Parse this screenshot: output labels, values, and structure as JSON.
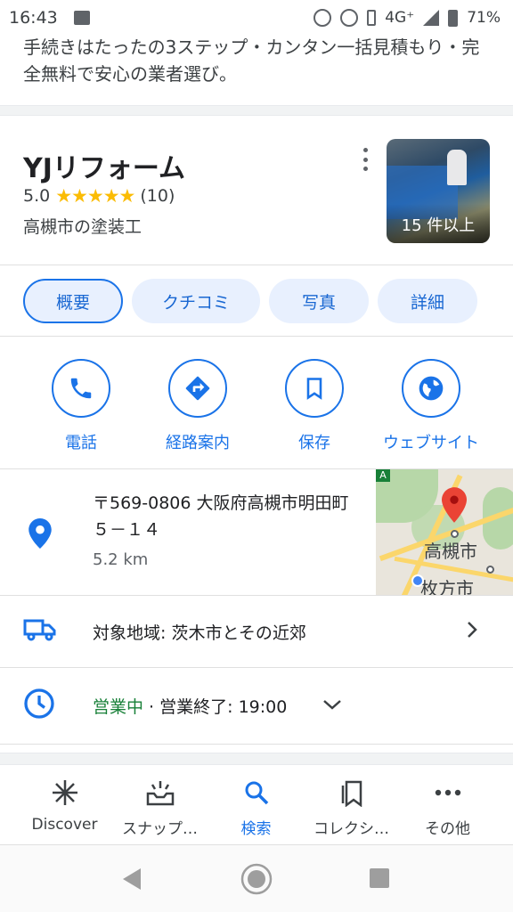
{
  "status_bar": {
    "time": "16:43",
    "network": "4G⁺",
    "battery": "71%"
  },
  "promo_text": "手続きはたったの3ステップ・カンタン一括見積もり・完全無料で安心の業者選び。",
  "business": {
    "name": "YJリフォーム",
    "rating": "5.0",
    "stars": "★★★★★",
    "review_count": "(10)",
    "category": "高槻市の塗装工",
    "photo_badge": "15 件以上"
  },
  "tabs": [
    {
      "label": "概要",
      "active": true
    },
    {
      "label": "クチコミ",
      "active": false
    },
    {
      "label": "写真",
      "active": false
    },
    {
      "label": "詳細",
      "active": false
    }
  ],
  "actions": [
    {
      "label": "電話",
      "icon": "phone-icon"
    },
    {
      "label": "経路案内",
      "icon": "directions-icon"
    },
    {
      "label": "保存",
      "icon": "bookmark-icon"
    },
    {
      "label": "ウェブサイト",
      "icon": "globe-icon"
    }
  ],
  "address": {
    "text": "〒569-0806 大阪府高槻市明田町５－１４",
    "distance": "5.2 km"
  },
  "map": {
    "city1": "高槻市",
    "city2": "枚方市",
    "corner": "A"
  },
  "service_area": "対象地域: 茨木市とその近郊",
  "hours": {
    "status": "営業中",
    "detail": " · 営業終了: 19:00"
  },
  "bottom_nav": [
    {
      "label": "Discover",
      "icon": "asterisk-icon",
      "active": false
    },
    {
      "label": "スナップ…",
      "icon": "snapshot-icon",
      "active": false
    },
    {
      "label": "検索",
      "icon": "search-icon",
      "active": true
    },
    {
      "label": "コレクシ…",
      "icon": "collections-icon",
      "active": false
    },
    {
      "label": "その他",
      "icon": "more-icon",
      "active": false
    }
  ],
  "colors": {
    "accent": "#1a73e8",
    "tab_bg": "#e8f0fe",
    "star": "#fbbc04",
    "open": "#188038",
    "pin": "#ea4335"
  }
}
